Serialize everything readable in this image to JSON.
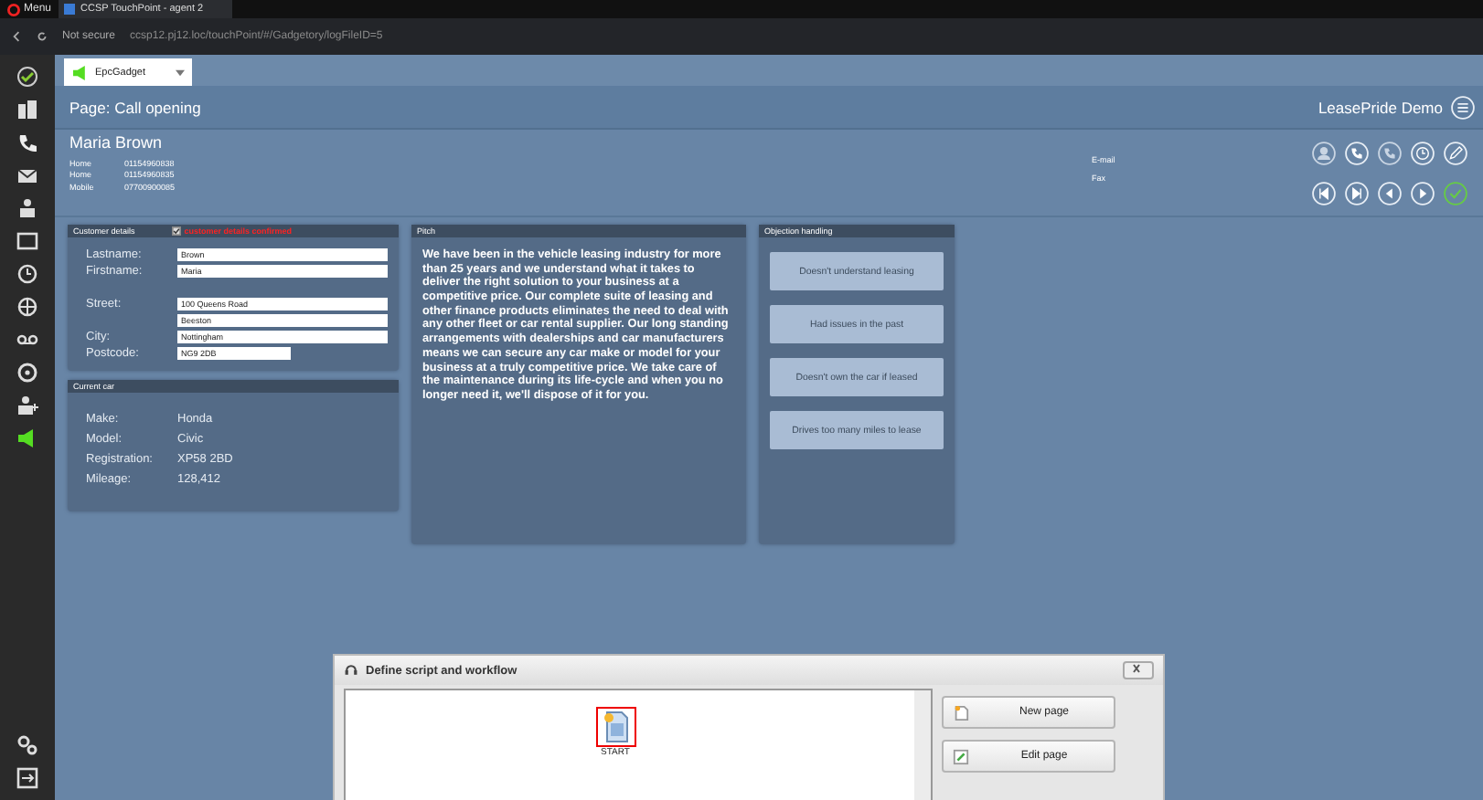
{
  "browser": {
    "menu": "Menu",
    "tab_title": "CCSP TouchPoint - agent 2",
    "security": "Not secure",
    "url": "ccsp12.pj12.loc/touchPoint/#/Gadgetory/logFileID=5"
  },
  "app_tab": {
    "label": "EpcGadget"
  },
  "page": {
    "title": "Page: Call opening",
    "account": "LeasePride Demo"
  },
  "contact": {
    "name": "Maria Brown",
    "phones": [
      {
        "label": "Home",
        "value": "01154960838"
      },
      {
        "label": "Home",
        "value": "01154960835"
      },
      {
        "label": "Mobile",
        "value": "07700900085"
      }
    ],
    "extra": [
      {
        "label": "E-mail"
      },
      {
        "label": "Fax"
      }
    ]
  },
  "customer_details": {
    "title": "Customer details",
    "confirmed": {
      "label": "customer details confirmed",
      "checked": true
    },
    "fields": [
      {
        "label": "Lastname:",
        "value": "Brown",
        "kind": "full"
      },
      {
        "label": "Firstname:",
        "value": "Maria",
        "kind": "full"
      },
      {
        "label": "Street:",
        "value": "100 Queens Road",
        "kind": "gap"
      },
      {
        "value": "Beeston",
        "kind": "full"
      },
      {
        "label": "City:",
        "value": "Nottingham",
        "kind": "full"
      },
      {
        "label": "Postcode:",
        "value": "NG9 2DB",
        "kind": "short"
      }
    ]
  },
  "current_car": {
    "title": "Current car",
    "rows": [
      {
        "label": "Make:",
        "value": "Honda"
      },
      {
        "label": "Model:",
        "value": "Civic"
      },
      {
        "label": "Registration:",
        "value": "XP58 2BD"
      },
      {
        "label": "Mileage:",
        "value": "128,412"
      }
    ]
  },
  "pitch": {
    "title": "Pitch",
    "text": "We have been in the vehicle leasing industry for more than 25 years and we understand what it takes to deliver the right solution to your business at a competitive price. Our complete suite of leasing and other finance products eliminates the need to deal with any other fleet or car rental supplier. Our long standing arrangements with dealerships and car manufacturers means we can secure any car make or model for your business at a truly competitive price. We take care of the maintenance during its life-cycle and when you no longer need it, we'll dispose of it for you."
  },
  "objection_handling": {
    "title": "Objection handling",
    "buttons": [
      "Doesn't understand leasing",
      "Had issues in the past",
      "Doesn't own the car if leased",
      "Drives too many miles to lease"
    ]
  },
  "dialog": {
    "title": "Define script and workflow",
    "node": {
      "label": "START",
      "selected": true
    },
    "buttons": [
      "New page",
      "Edit page"
    ]
  }
}
